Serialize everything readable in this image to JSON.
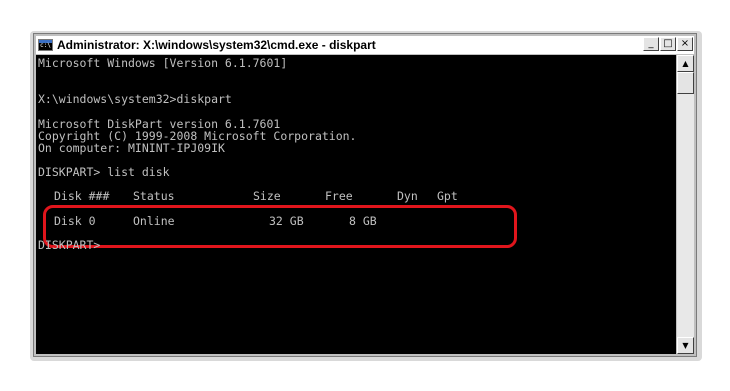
{
  "window": {
    "title": "Administrator: X:\\windows\\system32\\cmd.exe - diskpart",
    "icon": "cmd-icon",
    "buttons": {
      "minimize": "_",
      "maximize": "□",
      "close": "×"
    }
  },
  "console": {
    "lines": [
      "Microsoft Windows [Version 6.1.7601]",
      "",
      "X:\\windows\\system32>diskpart",
      "",
      "Microsoft DiskPart version 6.1.7601",
      "Copyright (C) 1999-2008 Microsoft Corporation.",
      "On computer: MININT-IPJ09IK",
      "",
      "DISKPART> list disk"
    ],
    "table": {
      "headers": [
        "Disk ###",
        "Status",
        "Size",
        "Free",
        "Dyn",
        "Gpt"
      ],
      "separators": [
        "--------",
        "-------------",
        "-------",
        "-------",
        "---",
        "---"
      ],
      "rows": [
        [
          "Disk 0",
          "Online",
          "32 GB",
          "8 GB",
          "",
          ""
        ]
      ]
    },
    "prompt": "DISKPART>"
  },
  "colors": {
    "console_bg": "#000000",
    "console_fg": "#c0c0c0",
    "highlight": "#e0151c"
  },
  "scrollbar": {
    "up": "▲",
    "down": "▼"
  }
}
